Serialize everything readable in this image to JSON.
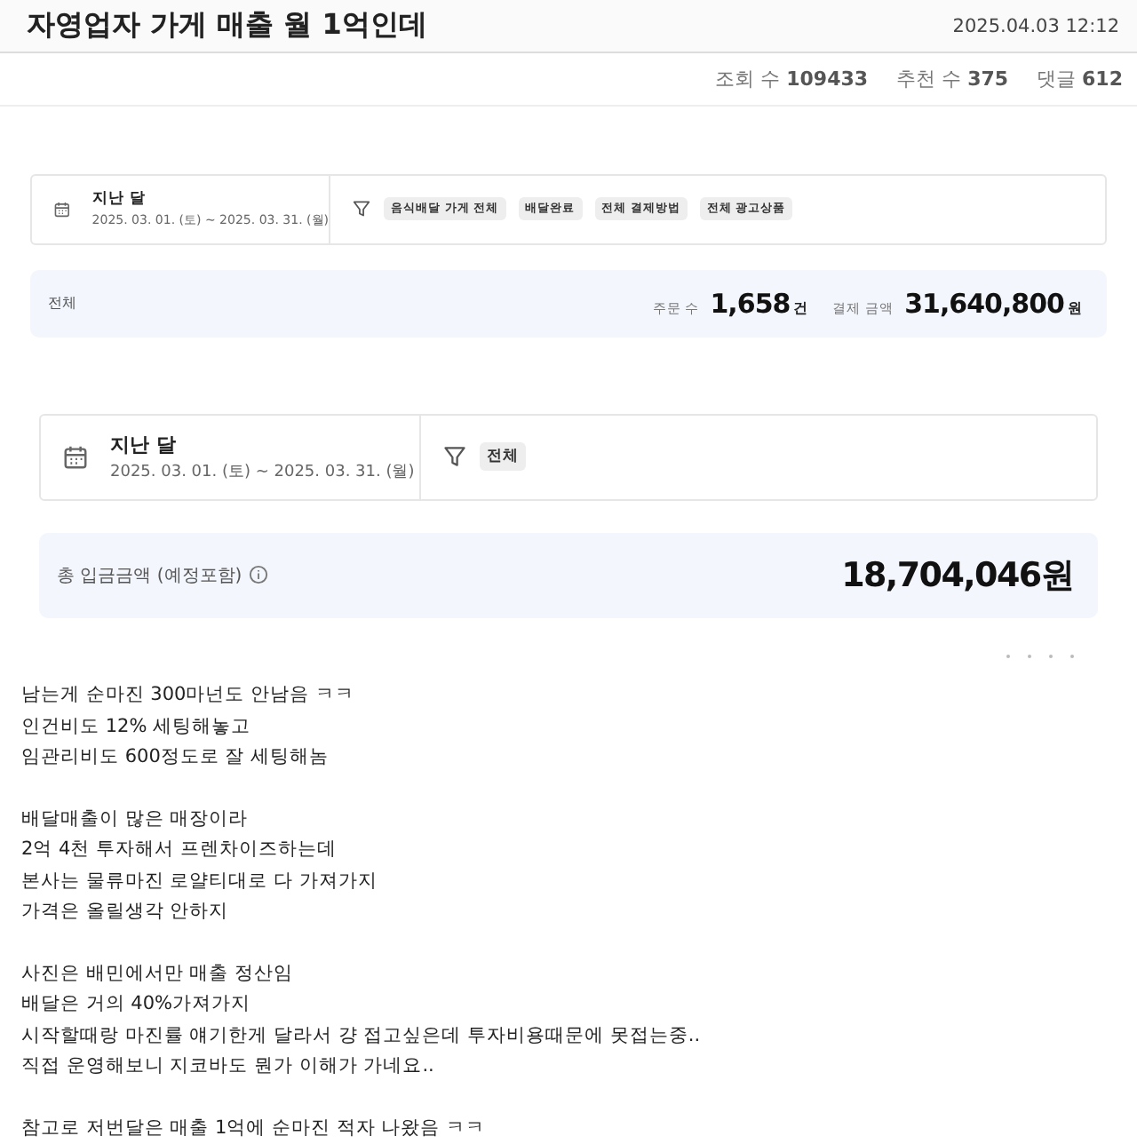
{
  "post": {
    "title": "자영업자 가게 매출 월 1억인데",
    "datetime": "2025.04.03 12:12"
  },
  "stats": [
    {
      "label": "조회 수",
      "value": "109433"
    },
    {
      "label": "추천 수",
      "value": "375"
    },
    {
      "label": "댓글",
      "value": "612"
    }
  ],
  "sales_screen": {
    "period": {
      "label": "지난 달",
      "range": "2025. 03. 01. (토) ~ 2025. 03. 31. (월)"
    },
    "filters": [
      "음식배달 가게 전체",
      "배달완료",
      "전체 결제방법",
      "전체 광고상품"
    ],
    "summary": {
      "label": "전체",
      "metrics": [
        {
          "label": "주문 수",
          "value": "1,658",
          "unit": "건"
        },
        {
          "label": "결제 금액",
          "value": "31,640,800",
          "unit": "원"
        }
      ]
    }
  },
  "deposit_screen": {
    "period": {
      "label": "지난 달",
      "range": "2025. 03. 01. (토) ~ 2025. 03. 31. (월)"
    },
    "filters": [
      "전체"
    ],
    "total": {
      "label": "총 입금금액 (예정포함)",
      "value": "18,704,046원"
    }
  },
  "body": [
    [
      "남는게 순마진 300마넌도 안남음 ㅋㅋ",
      "인건비도 12% 세팅해놓고",
      "임관리비도 600정도로 잘 세팅해놈"
    ],
    [
      "배달매출이 많은 매장이라",
      "2억 4천 투자해서 프렌차이즈하는데",
      "본사는 물류마진 로얄티대로 다 가져가지",
      "가격은 올릴생각 안하지"
    ],
    [
      "사진은 배민에서만 매출 정산임",
      "배달은 거의 40%가져가지",
      "시작할때랑 마진률 얘기한게 달라서 걍 접고싶은데 투자비용때문에 못접는중..",
      "직접 운영해보니 지코바도 뭔가 이해가 가네요.."
    ],
    [
      "참고로 저번달은 매출 1억에 순마진 적자 나왔음 ㅋㅋ"
    ]
  ]
}
